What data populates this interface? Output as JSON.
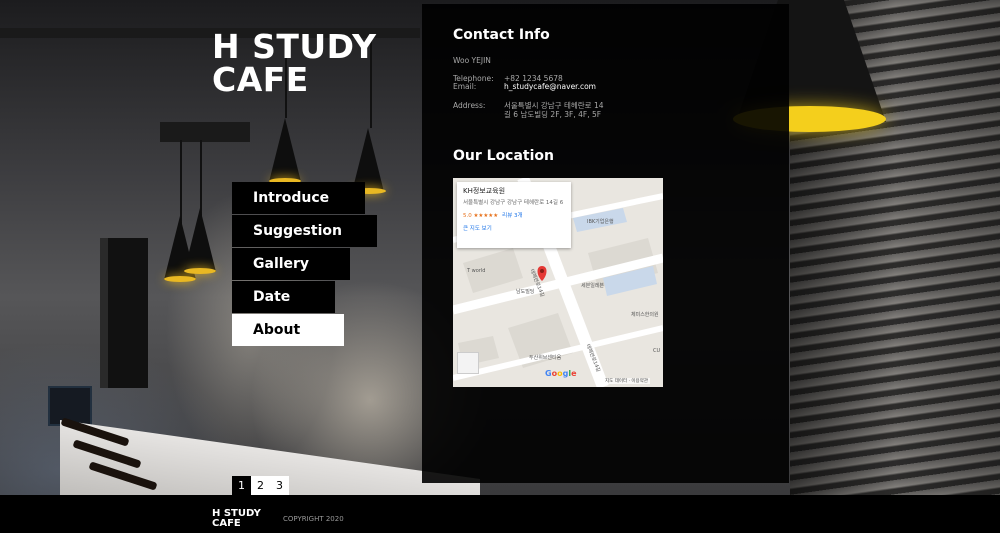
{
  "brand": {
    "line1": "H STUDY",
    "line2": "CAFE"
  },
  "nav": {
    "items": [
      {
        "label": "Introduce"
      },
      {
        "label": "Suggestion"
      },
      {
        "label": "Gallery"
      },
      {
        "label": "Date"
      },
      {
        "label": "About",
        "active": true
      }
    ]
  },
  "pagination": {
    "pages": [
      "1",
      "2",
      "3"
    ],
    "current": "1"
  },
  "contact": {
    "heading": "Contact Info",
    "name": "Woo YEJIN",
    "telephone_label": "Telephone:",
    "telephone": "+82 1234 5678",
    "email_label": "Email:",
    "email": "h_studycafe@naver.com",
    "address_label": "Address:",
    "address": "서울특별시 강남구 테헤란로 14길 6 남도빌딩 2F, 3F, 4F, 5F"
  },
  "location": {
    "heading": "Our Location",
    "card": {
      "title": "KH정보교육원",
      "address": "서울특별시 강남구 강남구 테헤란로 14길 6",
      "rating": "5.0",
      "stars": "★★★★★",
      "reviews": "리뷰 3개",
      "link": "큰 지도 보기"
    },
    "labels": {
      "ibk": "IBK기업은행",
      "tworld": "T world",
      "namdo": "남도빌딩",
      "seven": "세븐일레븐",
      "cheami": "체미스한의원",
      "cu": "CU",
      "doosan": "두산위브센티움",
      "road1": "테헤란로14길",
      "road2": "테헤란로14길"
    },
    "google": "Google",
    "footer": "지도 데이터 · 이용약관",
    "colors": {
      "pin": "#e53935",
      "road": "#ffffff",
      "block": "#dcd9d2",
      "park": "#c9d8ea"
    }
  },
  "footer": {
    "logo_line1": "H STUDY",
    "logo_line2": "CAFE",
    "copyright": "COPYRIGHT 2020"
  }
}
